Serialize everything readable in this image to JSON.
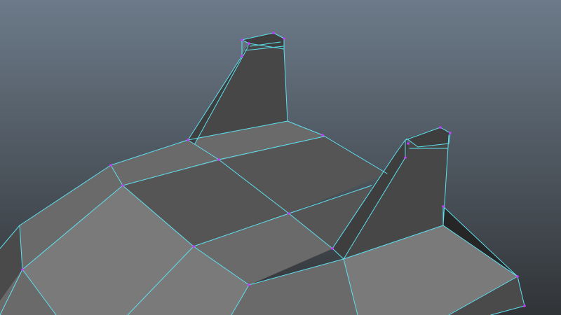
{
  "viewport": {
    "name": "3d-viewport",
    "background_top": "#6c7a89",
    "background_bottom": "#313437"
  },
  "mesh": {
    "name": "low-poly-mesh",
    "selection": "wireframe-on-shaded",
    "wireframe_color": "#5ee0f0",
    "vertex_color": "#c23cff",
    "shades": {
      "top_light": "#7a7a7a",
      "top_mid": "#6a6a6a",
      "top_dark": "#555555",
      "side": "#4a4a4a",
      "fin_side": "#474747",
      "fin_front": "#3e3e3e",
      "shadow": "#262626"
    }
  }
}
